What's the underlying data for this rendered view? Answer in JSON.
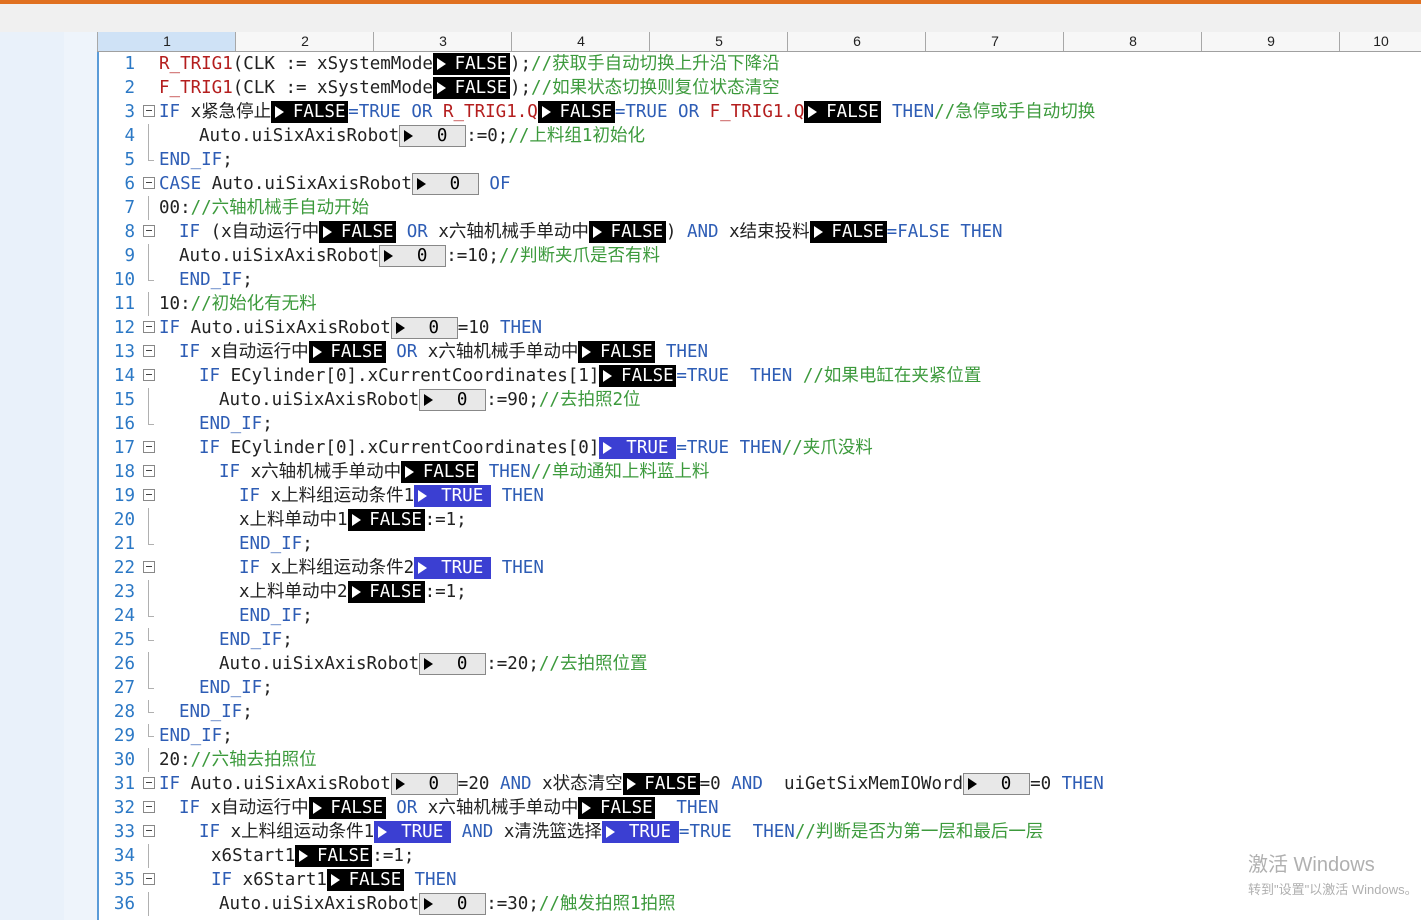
{
  "ruler": [
    "1",
    "2",
    "3",
    "4",
    "5",
    "6",
    "7",
    "8",
    "9",
    "10"
  ],
  "lines": [
    {
      "n": "1",
      "indent": 0,
      "parts": [
        [
          "fn",
          "R_TRIG1"
        ],
        [
          "t",
          "(CLK := xSystemMode"
        ],
        [
          "mb",
          "FALSE"
        ],
        [
          "t",
          ");"
        ],
        [
          "cm",
          "//获取手自动切换上升沿下降沿"
        ]
      ]
    },
    {
      "n": "2",
      "indent": 0,
      "parts": [
        [
          "fn",
          "F_TRIG1"
        ],
        [
          "t",
          "(CLK := xSystemMode"
        ],
        [
          "mb",
          "FALSE"
        ],
        [
          "t",
          ");"
        ],
        [
          "cm",
          "//如果状态切换则复位状态清空"
        ]
      ]
    },
    {
      "n": "3",
      "indent": 0,
      "fold": true,
      "parts": [
        [
          "kw",
          "IF"
        ],
        [
          "t",
          " x紧急停止"
        ],
        [
          "mb",
          "FALSE"
        ],
        [
          "kw",
          "=TRUE OR "
        ],
        [
          "fn",
          "R_TRIG1.Q"
        ],
        [
          "mb",
          "FALSE"
        ],
        [
          "kw",
          "=TRUE OR "
        ],
        [
          "fn",
          "F_TRIG1.Q"
        ],
        [
          "mb",
          "FALSE"
        ],
        [
          "kw",
          " THEN"
        ],
        [
          "cm",
          "//急停或手自动切换"
        ]
      ]
    },
    {
      "n": "4",
      "indent": 2,
      "parts": [
        [
          "t",
          "Auto.uiSixAxisRobot"
        ],
        [
          "mn",
          "0"
        ],
        [
          "t",
          ":=0;"
        ],
        [
          "cm",
          "//上料组1初始化"
        ]
      ]
    },
    {
      "n": "5",
      "indent": 0,
      "parts": [
        [
          "kw",
          "END_IF"
        ],
        [
          "t",
          ";"
        ]
      ]
    },
    {
      "n": "6",
      "indent": 0,
      "fold": true,
      "parts": [
        [
          "kw",
          "CASE"
        ],
        [
          "t",
          " Auto.uiSixAxisRobot"
        ],
        [
          "mn",
          "0"
        ],
        [
          "kw",
          " OF"
        ]
      ]
    },
    {
      "n": "7",
      "indent": 0,
      "parts": [
        [
          "t",
          "00:"
        ],
        [
          "cm",
          "//六轴机械手自动开始"
        ]
      ]
    },
    {
      "n": "8",
      "indent": 1,
      "fold": true,
      "parts": [
        [
          "kw",
          "IF"
        ],
        [
          "t",
          " (x自动运行中"
        ],
        [
          "mb",
          "FALSE"
        ],
        [
          "kw",
          " OR"
        ],
        [
          "t",
          " x六轴机械手单动中"
        ],
        [
          "mb",
          "FALSE"
        ],
        [
          "t",
          ")"
        ],
        [
          "kw",
          " AND"
        ],
        [
          "t",
          " x结束投料"
        ],
        [
          "mb",
          "FALSE"
        ],
        [
          "kw",
          "=FALSE THEN"
        ]
      ]
    },
    {
      "n": "9",
      "indent": 1,
      "parts": [
        [
          "t",
          "Auto.uiSixAxisRobot"
        ],
        [
          "mn",
          "0"
        ],
        [
          "t",
          ":=10;"
        ],
        [
          "cm",
          "//判断夹爪是否有料"
        ]
      ]
    },
    {
      "n": "10",
      "indent": 1,
      "parts": [
        [
          "kw",
          "END_IF"
        ],
        [
          "t",
          ";"
        ]
      ]
    },
    {
      "n": "11",
      "indent": 0,
      "parts": [
        [
          "t",
          "10:"
        ],
        [
          "cm",
          "//初始化有无料"
        ]
      ]
    },
    {
      "n": "12",
      "indent": 0,
      "fold": true,
      "parts": [
        [
          "kw",
          "IF"
        ],
        [
          "t",
          " Auto.uiSixAxisRobot"
        ],
        [
          "mn",
          "0"
        ],
        [
          "t",
          "=10"
        ],
        [
          "kw",
          " THEN"
        ]
      ]
    },
    {
      "n": "13",
      "indent": 1,
      "fold": true,
      "parts": [
        [
          "kw",
          "IF"
        ],
        [
          "t",
          " x自动运行中"
        ],
        [
          "mb",
          "FALSE"
        ],
        [
          "kw",
          " OR"
        ],
        [
          "t",
          " x六轴机械手单动中"
        ],
        [
          "mb",
          "FALSE"
        ],
        [
          "kw",
          " THEN"
        ]
      ]
    },
    {
      "n": "14",
      "indent": 2,
      "fold": true,
      "parts": [
        [
          "kw",
          "IF"
        ],
        [
          "t",
          " ECylinder[0].xCurrentCoordinates[1]"
        ],
        [
          "mb",
          "FALSE"
        ],
        [
          "kw",
          "=TRUE  THEN"
        ],
        [
          "cm",
          " //如果电缸在夹紧位置"
        ]
      ]
    },
    {
      "n": "15",
      "indent": 3,
      "parts": [
        [
          "t",
          "Auto.uiSixAxisRobot"
        ],
        [
          "mn",
          "0"
        ],
        [
          "t",
          ":=90;"
        ],
        [
          "cm",
          "//去拍照2位"
        ]
      ]
    },
    {
      "n": "16",
      "indent": 2,
      "parts": [
        [
          "kw",
          "END_IF"
        ],
        [
          "t",
          ";"
        ]
      ]
    },
    {
      "n": "17",
      "indent": 2,
      "fold": true,
      "parts": [
        [
          "kw",
          "IF"
        ],
        [
          "t",
          " ECylinder[0].xCurrentCoordinates[0]"
        ],
        [
          "mt",
          "TRUE"
        ],
        [
          "kw",
          "=TRUE THEN"
        ],
        [
          "cm",
          "//夹爪没料"
        ]
      ]
    },
    {
      "n": "18",
      "indent": 3,
      "fold": true,
      "parts": [
        [
          "kw",
          "IF"
        ],
        [
          "t",
          " x六轴机械手单动中"
        ],
        [
          "mb",
          "FALSE"
        ],
        [
          "kw",
          " THEN"
        ],
        [
          "cm",
          "//单动通知上料蓝上料"
        ]
      ]
    },
    {
      "n": "19",
      "indent": 4,
      "fold": true,
      "parts": [
        [
          "kw",
          "IF"
        ],
        [
          "t",
          " x上料组运动条件1"
        ],
        [
          "mt",
          "TRUE"
        ],
        [
          "kw",
          " THEN"
        ]
      ]
    },
    {
      "n": "20",
      "indent": 4,
      "current": true,
      "parts": [
        [
          "t",
          "x上料单动中1"
        ],
        [
          "mb",
          "FALSE"
        ],
        [
          "t",
          ":=1;"
        ]
      ]
    },
    {
      "n": "21",
      "indent": 4,
      "parts": [
        [
          "kw",
          "END_IF"
        ],
        [
          "t",
          ";"
        ]
      ]
    },
    {
      "n": "22",
      "indent": 4,
      "fold": true,
      "parts": [
        [
          "kw",
          "IF"
        ],
        [
          "t",
          " x上料组运动条件2"
        ],
        [
          "mt",
          "TRUE"
        ],
        [
          "kw",
          " THEN"
        ]
      ]
    },
    {
      "n": "23",
      "indent": 4,
      "parts": [
        [
          "t",
          "x上料单动中2"
        ],
        [
          "mb",
          "FALSE"
        ],
        [
          "t",
          ":=1;"
        ]
      ]
    },
    {
      "n": "24",
      "indent": 4,
      "parts": [
        [
          "kw",
          "END_IF"
        ],
        [
          "t",
          ";"
        ]
      ]
    },
    {
      "n": "25",
      "indent": 3,
      "parts": [
        [
          "kw",
          "END_IF"
        ],
        [
          "t",
          ";"
        ]
      ]
    },
    {
      "n": "26",
      "indent": 3,
      "parts": [
        [
          "t",
          "Auto.uiSixAxisRobot"
        ],
        [
          "mn",
          "0"
        ],
        [
          "t",
          ":=20;"
        ],
        [
          "cm",
          "//去拍照位置"
        ]
      ]
    },
    {
      "n": "27",
      "indent": 2,
      "parts": [
        [
          "kw",
          "END_IF"
        ],
        [
          "t",
          ";"
        ]
      ]
    },
    {
      "n": "28",
      "indent": 1,
      "parts": [
        [
          "kw",
          "END_IF"
        ],
        [
          "t",
          ";"
        ]
      ]
    },
    {
      "n": "29",
      "indent": 0,
      "parts": [
        [
          "kw",
          "END_IF"
        ],
        [
          "t",
          ";"
        ]
      ]
    },
    {
      "n": "30",
      "indent": 0,
      "parts": [
        [
          "t",
          "20:"
        ],
        [
          "cm",
          "//六轴去拍照位"
        ]
      ]
    },
    {
      "n": "31",
      "indent": 0,
      "fold": true,
      "parts": [
        [
          "kw",
          "IF"
        ],
        [
          "t",
          " Auto.uiSixAxisRobot"
        ],
        [
          "mn",
          "0"
        ],
        [
          "t",
          "=20"
        ],
        [
          "kw",
          " AND"
        ],
        [
          "t",
          " x状态清空"
        ],
        [
          "mb",
          "FALSE"
        ],
        [
          "t",
          "=0"
        ],
        [
          "kw",
          " AND"
        ],
        [
          "t",
          "  uiGetSixMemIOWord"
        ],
        [
          "mn",
          "0"
        ],
        [
          "t",
          "=0"
        ],
        [
          "kw",
          " THEN"
        ]
      ]
    },
    {
      "n": "32",
      "indent": 1,
      "fold": true,
      "parts": [
        [
          "kw",
          "IF"
        ],
        [
          "t",
          " x自动运行中"
        ],
        [
          "mb",
          "FALSE"
        ],
        [
          "kw",
          " OR"
        ],
        [
          "t",
          " x六轴机械手单动中"
        ],
        [
          "mb",
          "FALSE"
        ],
        [
          "kw",
          "  THEN"
        ]
      ]
    },
    {
      "n": "33",
      "indent": 2,
      "fold": true,
      "parts": [
        [
          "kw",
          "IF"
        ],
        [
          "t",
          " x上料组运动条件1"
        ],
        [
          "mt",
          "TRUE"
        ],
        [
          "kw",
          " AND"
        ],
        [
          "t",
          " x清洗篮选择"
        ],
        [
          "mt",
          "TRUE"
        ],
        [
          "kw",
          "=TRUE  THEN"
        ],
        [
          "cm",
          "//判断是否为第一层和最后一层"
        ]
      ]
    },
    {
      "n": "34",
      "indent": 2.6,
      "parts": [
        [
          "t",
          "x6Start1"
        ],
        [
          "mb",
          "FALSE"
        ],
        [
          "t",
          ":=1;"
        ]
      ]
    },
    {
      "n": "35",
      "indent": 2.6,
      "fold": true,
      "parts": [
        [
          "kw",
          "IF"
        ],
        [
          "t",
          " x6Start1"
        ],
        [
          "mb",
          "FALSE"
        ],
        [
          "kw",
          " THEN"
        ]
      ]
    },
    {
      "n": "36",
      "indent": 3,
      "parts": [
        [
          "t",
          "Auto.uiSixAxisRobot"
        ],
        [
          "mn",
          "0"
        ],
        [
          "t",
          ":=30;"
        ],
        [
          "cm",
          "//触发拍照1拍照"
        ]
      ]
    }
  ],
  "watermark": {
    "title": "激活 Windows",
    "subtitle": "转到\"设置\"以激活 Windows。"
  }
}
